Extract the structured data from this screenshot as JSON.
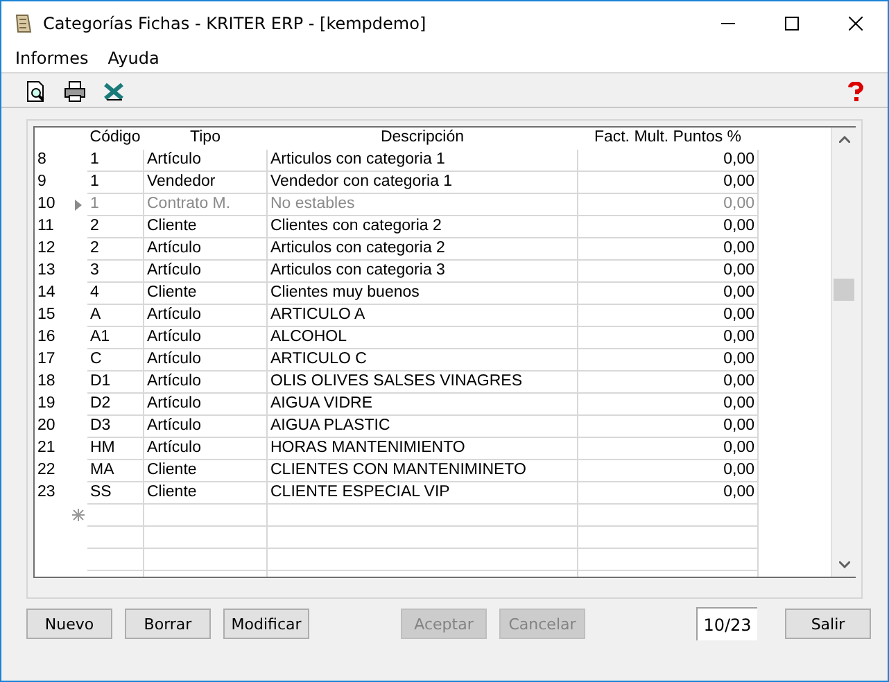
{
  "window": {
    "title": "Categorías Fichas - KRITER ERP - [kempdemo]"
  },
  "menu": [
    "Informes",
    "Ayuda"
  ],
  "table": {
    "columns": [
      "Código",
      "Tipo",
      "Descripción",
      "Fact. Mult. Puntos %"
    ],
    "rows": [
      {
        "number": "8",
        "code": "1",
        "type": "Artículo",
        "description": "Articulos con categoria 1",
        "factor": "0,00",
        "disabled": false,
        "current": false
      },
      {
        "number": "9",
        "code": "1",
        "type": "Vendedor",
        "description": "Vendedor con categoria 1",
        "factor": "0,00",
        "disabled": false,
        "current": false
      },
      {
        "number": "10",
        "code": "1",
        "type": "Contrato M.",
        "description": "No estables",
        "factor": "0,00",
        "disabled": true,
        "current": true
      },
      {
        "number": "11",
        "code": "2",
        "type": "Cliente",
        "description": "Clientes con categoria 2",
        "factor": "0,00",
        "disabled": false,
        "current": false
      },
      {
        "number": "12",
        "code": "2",
        "type": "Artículo",
        "description": "Articulos con categoria 2",
        "factor": "0,00",
        "disabled": false,
        "current": false
      },
      {
        "number": "13",
        "code": "3",
        "type": "Artículo",
        "description": "Articulos con categoria 3",
        "factor": "0,00",
        "disabled": false,
        "current": false
      },
      {
        "number": "14",
        "code": "4",
        "type": "Cliente",
        "description": "Clientes muy buenos",
        "factor": "0,00",
        "disabled": false,
        "current": false
      },
      {
        "number": "15",
        "code": "A",
        "type": "Artículo",
        "description": "ARTICULO A",
        "factor": "0,00",
        "disabled": false,
        "current": false
      },
      {
        "number": "16",
        "code": "A1",
        "type": "Artículo",
        "description": "ALCOHOL",
        "factor": "0,00",
        "disabled": false,
        "current": false
      },
      {
        "number": "17",
        "code": "C",
        "type": "Artículo",
        "description": "ARTICULO C",
        "factor": "0,00",
        "disabled": false,
        "current": false
      },
      {
        "number": "18",
        "code": "D1",
        "type": "Artículo",
        "description": "OLIS OLIVES SALSES VINAGRES",
        "factor": "0,00",
        "disabled": false,
        "current": false
      },
      {
        "number": "19",
        "code": "D2",
        "type": "Artículo",
        "description": "AIGUA VIDRE",
        "factor": "0,00",
        "disabled": false,
        "current": false
      },
      {
        "number": "20",
        "code": "D3",
        "type": "Artículo",
        "description": "AIGUA PLASTIC",
        "factor": "0,00",
        "disabled": false,
        "current": false
      },
      {
        "number": "21",
        "code": "HM",
        "type": "Artículo",
        "description": "HORAS MANTENIMIENTO",
        "factor": "0,00",
        "disabled": false,
        "current": false
      },
      {
        "number": "22",
        "code": "MA",
        "type": "Cliente",
        "description": "CLIENTES CON MANTENIMINETO",
        "factor": "0,00",
        "disabled": false,
        "current": false
      },
      {
        "number": "23",
        "code": "SS",
        "type": "Cliente",
        "description": "CLIENTE ESPECIAL VIP",
        "factor": "0,00",
        "disabled": false,
        "current": false
      }
    ]
  },
  "buttons": [
    {
      "label": "Nuevo",
      "disabled": false
    },
    {
      "label": "Borrar",
      "disabled": false
    },
    {
      "label": "Modificar",
      "disabled": false
    },
    {
      "label": "Aceptar",
      "disabled": true
    },
    {
      "label": "Cancelar",
      "disabled": true
    }
  ],
  "record_counter": "10/23",
  "exit_button": {
    "label": "Salir"
  }
}
